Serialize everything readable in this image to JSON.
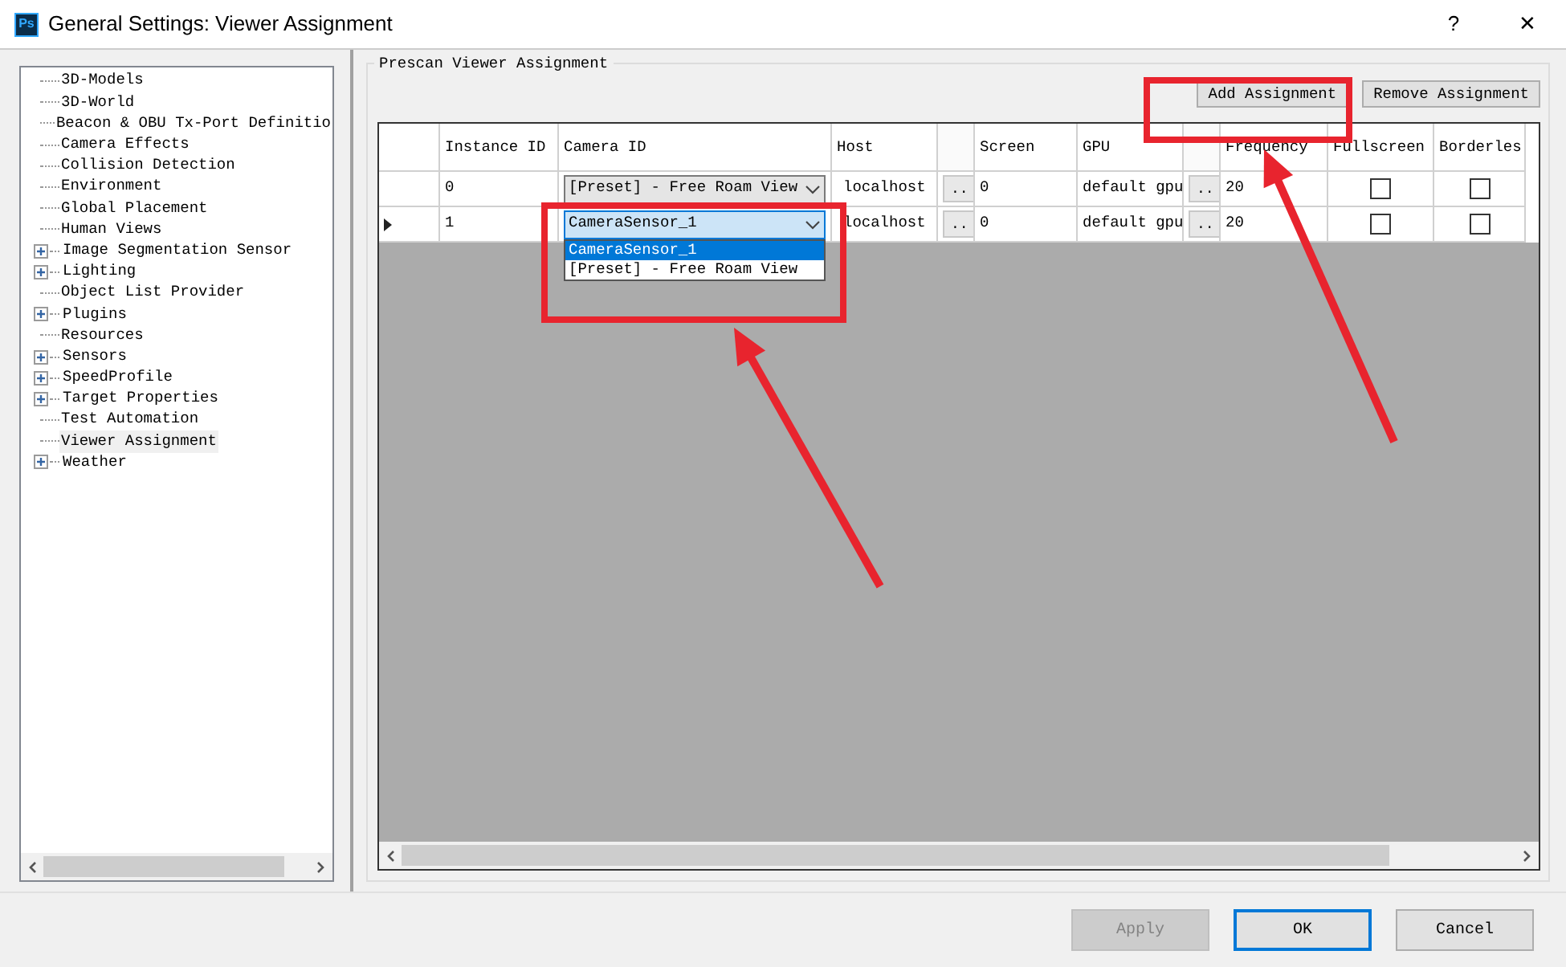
{
  "window": {
    "app_icon": "Ps",
    "title": "General Settings: Viewer Assignment",
    "help": "?",
    "close": "✕"
  },
  "tree": {
    "items": [
      {
        "label": "3D-Models",
        "collapsed": false,
        "selected": false
      },
      {
        "label": "3D-World",
        "collapsed": false,
        "selected": false
      },
      {
        "label": "Beacon & OBU Tx-Port Definitio",
        "collapsed": false,
        "selected": false
      },
      {
        "label": "Camera Effects",
        "collapsed": false,
        "selected": false
      },
      {
        "label": "Collision Detection",
        "collapsed": false,
        "selected": false
      },
      {
        "label": "Environment",
        "collapsed": false,
        "selected": false
      },
      {
        "label": "Global Placement",
        "collapsed": false,
        "selected": false
      },
      {
        "label": "Human Views",
        "collapsed": false,
        "selected": false
      },
      {
        "label": "Image Segmentation Sensor",
        "collapsed": true,
        "selected": false
      },
      {
        "label": "Lighting",
        "collapsed": true,
        "selected": false
      },
      {
        "label": "Object List Provider",
        "collapsed": false,
        "selected": false
      },
      {
        "label": "Plugins",
        "collapsed": true,
        "selected": false
      },
      {
        "label": "Resources",
        "collapsed": false,
        "selected": false
      },
      {
        "label": "Sensors",
        "collapsed": true,
        "selected": false
      },
      {
        "label": "SpeedProfile",
        "collapsed": true,
        "selected": false
      },
      {
        "label": "Target Properties",
        "collapsed": true,
        "selected": false
      },
      {
        "label": "Test Automation",
        "collapsed": false,
        "selected": false
      },
      {
        "label": "Viewer Assignment",
        "collapsed": false,
        "selected": true
      },
      {
        "label": "Weather",
        "collapsed": true,
        "selected": false
      }
    ]
  },
  "group": {
    "title": "Prescan Viewer Assignment",
    "buttons": [
      "Add Assignment",
      "Remove Assignment"
    ]
  },
  "grid": {
    "columns": [
      {
        "label": "Instance ID"
      },
      {
        "label": "Camera ID"
      },
      {
        "label": "Host"
      },
      {
        "kind": "button"
      },
      {
        "label": "Screen"
      },
      {
        "label": "GPU"
      },
      {
        "kind": "button"
      },
      {
        "label": "Frequency"
      },
      {
        "label": "Fullscreen"
      },
      {
        "label": "Borderles"
      }
    ],
    "rows": [
      {
        "current": false,
        "instance_id": "0",
        "camera_id": "[Preset] - Free Roam View",
        "camera_focused": false,
        "host": "localhost",
        "host_button": "..",
        "screen": "0",
        "gpu": "default gpu",
        "gpu_button": "..",
        "frequency": "20",
        "fullscreen": false,
        "borderless": false
      },
      {
        "current": true,
        "instance_id": "1",
        "camera_id": "CameraSensor_1",
        "camera_focused": true,
        "host": "localhost",
        "host_button": "..",
        "screen": "0",
        "gpu": "default gpu",
        "gpu_button": "..",
        "frequency": "20",
        "fullscreen": false,
        "borderless": false
      }
    ],
    "dropdown": {
      "options": [
        {
          "label": "CameraSensor_1",
          "selected": true
        },
        {
          "label": "[Preset] - Free Roam View",
          "selected": false
        }
      ]
    }
  },
  "footer": {
    "buttons": [
      {
        "label": "Apply",
        "disabled": true,
        "default": false
      },
      {
        "label": "OK",
        "disabled": false,
        "default": true
      },
      {
        "label": "Cancel",
        "disabled": false,
        "default": false
      }
    ]
  },
  "annotations": [
    {
      "kind": "frame"
    },
    {
      "kind": "frame"
    },
    {
      "kind": "arrow"
    },
    {
      "kind": "arrow"
    }
  ]
}
